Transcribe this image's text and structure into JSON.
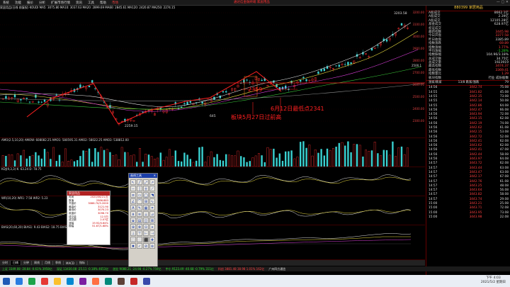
{
  "menu": {
    "items": [
      "系统",
      "功能",
      "报价",
      "分析",
      "扩展市场行情",
      "资讯",
      "工具",
      "帮助",
      "市场"
    ],
    "app_title": "通达信金融终端 家居用品"
  },
  "stock_header": "家居用品(日线 前复权) KOUDI MA5: 3075.80 MA10: 3037.63 MA20: 2899.69 MA60: 2845.61 MA120: 2420.87 MA250: 2274.15",
  "main_axis": [
    "3200.00",
    "3100.00",
    "3000.00",
    "2900.00",
    "2800.00",
    "2700.00",
    "2600.00",
    "2500.00",
    "2400.00",
    "2300.00"
  ],
  "annotations": {
    "low2359": "2359",
    "text1": "板块5月27日过前高",
    "text2": "6月12日最低点2341",
    "peak": "3203.58",
    "low": "2259.15",
    "mid": "2500.1",
    "small": "645"
  },
  "indicator_labels": {
    "vol": "AMO(2.5,10,20) AMOW: 608082.25 AMO1: 580595.31 AMO2: 58022.25 AMO3: 538812.00",
    "kdj": "KDJ(9,3,3) K: 63.24 D: 78.75",
    "wr": "WR(10,20) WR1: 7.58 WR2: 5.23",
    "bias": "BIAS(20,60,20) BIAS1: 9.43 BIAS2: 18.75 BIAS3: 32.65"
  },
  "right_panel": {
    "code_line": "880399 家居用品",
    "stats": [
      {
        "k": "A股成交",
        "v": "8662.1亿",
        "c": "w"
      },
      {
        "k": "A股成交",
        "v": "2.39亿",
        "c": "w"
      },
      {
        "k": "A股成交",
        "v": "12105.28亿",
        "c": "w"
      },
      {
        "k": "基金成交",
        "v": "628.97亿",
        "c": "w"
      },
      {
        "k": "权证成交",
        "v": "",
        "c": "w"
      },
      {
        "k": "最新指数",
        "v": "3445.98",
        "c": "r"
      },
      {
        "k": "今日开盘",
        "v": "3377.58",
        "c": "r"
      },
      {
        "k": "昨日收盘",
        "v": "3385.89",
        "c": "w"
      },
      {
        "k": "指数涨跌",
        "v": "69.89",
        "c": "r"
      },
      {
        "k": "指数涨幅",
        "v": "1.77%",
        "c": "r"
      },
      {
        "k": "平均涨幅",
        "v": "-1.28%",
        "c": "g"
      },
      {
        "k": "指数振幅",
        "v": "104.96/3.18%",
        "c": "w"
      },
      {
        "k": "总成交额",
        "v": "34.75亿",
        "c": "w"
      },
      {
        "k": "总成交量",
        "v": "1923919",
        "c": "w"
      },
      {
        "k": "最高指数",
        "v": "3474.37",
        "c": "r"
      },
      {
        "k": "最低指数",
        "v": "3369.41",
        "c": "r"
      },
      {
        "k": "指数量比",
        "v": "1.29",
        "c": "r"
      },
      {
        "k": "板块指数",
        "v": "行业 成份股数",
        "c": "w"
      }
    ],
    "tick_header": [
      "涨家/跌家",
      "13/8 跌家/涨跌",
      "79"
    ],
    "ticks": [
      {
        "t": "14:56",
        "p": "3442.74",
        "v": "75.08"
      },
      {
        "t": "14:55",
        "p": "3441.82",
        "v": "45.08"
      },
      {
        "t": "14:55",
        "p": "3442.35",
        "v": "73.08"
      },
      {
        "t": "14:55",
        "p": "3442.14",
        "v": "50.08"
      },
      {
        "t": "14:55",
        "p": "3442.86",
        "v": "64.08"
      },
      {
        "t": "14:56",
        "p": "3442.47",
        "v": "66.08"
      },
      {
        "t": "14:56",
        "p": "3443.94",
        "v": "72.08"
      },
      {
        "t": "14:56",
        "p": "3443.15",
        "v": "62.08"
      },
      {
        "t": "14:56",
        "p": "3442.19",
        "v": "74.08"
      },
      {
        "t": "14:56",
        "p": "3442.62",
        "v": "61.08"
      },
      {
        "t": "14:56",
        "p": "3442.15",
        "v": "53.08"
      },
      {
        "t": "14:56",
        "p": "3442.72",
        "v": "52.08"
      },
      {
        "t": "14:56",
        "p": "3442.41",
        "v": "62.08"
      },
      {
        "t": "14:56",
        "p": "3443.62",
        "v": "62.08"
      },
      {
        "t": "14:56",
        "p": "3442.41",
        "v": "47.08"
      },
      {
        "t": "14:56",
        "p": "3442.44",
        "v": "58.08"
      },
      {
        "t": "14:56",
        "p": "3443.97",
        "v": "64.08"
      },
      {
        "t": "14:57",
        "p": "3443.72",
        "v": "62.08"
      },
      {
        "t": "14:57",
        "p": "3443.44",
        "v": "63.08"
      },
      {
        "t": "14:57",
        "p": "3443.47",
        "v": "63.08"
      },
      {
        "t": "14:57",
        "p": "3442.17",
        "v": "67.08"
      },
      {
        "t": "14:57",
        "p": "3442.76",
        "v": "61.08"
      },
      {
        "t": "14:57",
        "p": "3443.25",
        "v": "48.08"
      },
      {
        "t": "14:57",
        "p": "3443.64",
        "v": "56.08"
      },
      {
        "t": "14:57",
        "p": "3443.82",
        "v": "58.08"
      },
      {
        "t": "14:57",
        "p": "3443.74",
        "v": "29.08"
      },
      {
        "t": "15:00",
        "p": "3443.21",
        "v": "25.08"
      },
      {
        "t": "15:00",
        "p": "3443.71",
        "v": "72.08"
      },
      {
        "t": "15:00",
        "p": "3443.95",
        "v": "73.08"
      },
      {
        "t": "15:00",
        "p": "3443.98",
        "v": "22.08"
      }
    ]
  },
  "palette": {
    "title": "画线工具",
    "tools": [
      "↖",
      "╱",
      "⤢",
      "↗",
      "─",
      "│",
      "┼",
      "⟋",
      "≡",
      "▭",
      "◯",
      "◥",
      "∠",
      "⌒",
      "⊞",
      "∿",
      "A",
      "✎",
      "▦",
      "⌗",
      "⋔",
      "≋",
      "⟂",
      "⊿",
      "⧈",
      "▤",
      "◫",
      "⊠",
      "⊕",
      "⊗",
      "⊙",
      "⌖",
      "⊥",
      "⊤",
      "⊢",
      "⊣",
      "⬚",
      "⬜",
      "⬛",
      "✚",
      "✖",
      "✓",
      "⊘",
      "⊚"
    ]
  },
  "infobox": {
    "title": "家居用品",
    "rows": [
      [
        "时间",
        "2020/06/21/五"
      ],
      [
        "数值",
        "2586.883"
      ],
      [
        "开盘价",
        "3086.70/3.2000"
      ],
      [
        "最高价",
        "3121.90"
      ],
      [
        "最低价",
        "3070.23"
      ],
      [
        "收盘价",
        "3096.70"
      ],
      [
        "成交量",
        "12.5万"
      ],
      [
        "成交额",
        "2.07亿"
      ],
      [
        "涨幅",
        "19.92/0.64%"
      ],
      [
        "振幅",
        "51.67/1.68%"
      ]
    ]
  },
  "tabs": [
    "分时",
    "日线",
    "分钟",
    "周线",
    "月线",
    "季线",
    "MACD",
    "指标"
  ],
  "status": [
    {
      "text": "上证 3349.08 -28.84 -0.61% 3958亿",
      "c": "g"
    },
    {
      "text": "深证 13430.08 -25.11 -0.18% 4653亿",
      "c": "g"
    },
    {
      "text": "创业 9088.21 -24.98 -0.27% 759亿",
      "c": "g"
    },
    {
      "text": "中小 9123.49 -40.68 -0.79% 311亿",
      "c": "g"
    },
    {
      "text": "科创 3881.48 38.98 1.01% 162亿",
      "c": "r"
    },
    {
      "text": "广州四方通信",
      "c": "w"
    }
  ],
  "clock": {
    "time": "下午 4:03",
    "date": "2021/5/2 星期日"
  },
  "taskbar_colors": [
    "#2a7de1",
    "#1aa34a",
    "#e53935",
    "#fbc02d",
    "#0288d1",
    "#7b1fa2",
    "#ff7043",
    "#00897b",
    "#5d4037",
    "#c62828",
    "#3949ab"
  ]
}
